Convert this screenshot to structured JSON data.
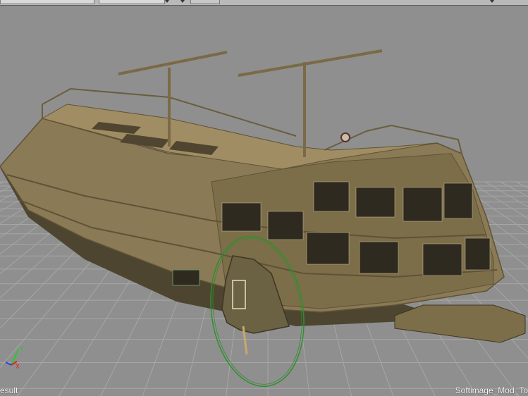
{
  "viewport": {
    "status_left": "esult",
    "status_right": "Softimage_Mod_To"
  },
  "axis_gizmo": {
    "y_label": "Y",
    "x_label": "X",
    "y_color": "#22cc22",
    "x_color": "#dd2222",
    "z_color": "#2244ff"
  },
  "colors": {
    "viewport_bg": "#8f8f8f",
    "grid_line": "#a8a8a8",
    "selection_ring": "#2e8f2e",
    "hull": "#8a7a55",
    "hull_dark": "#5f5237"
  }
}
